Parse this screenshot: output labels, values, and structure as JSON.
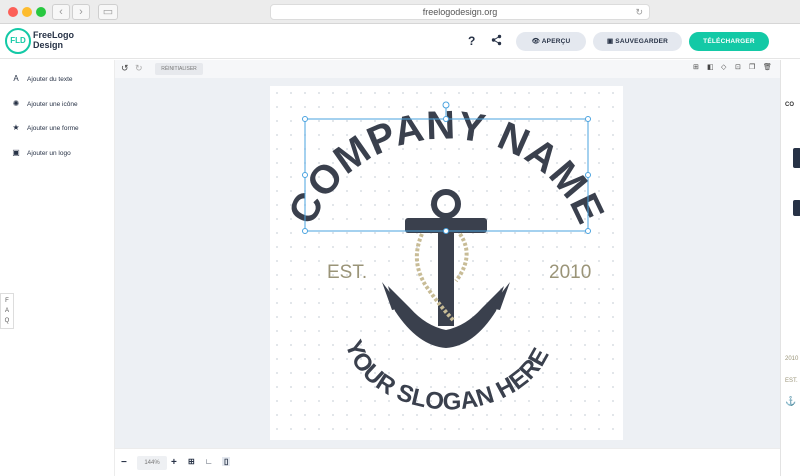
{
  "browser": {
    "url": "freelogodesign.org"
  },
  "header": {
    "logo_mark": "FLD",
    "logo_name": "FreeLogo Design",
    "help_icon": "?",
    "share_icon": "share-icon",
    "preview_label": "APERÇU",
    "save_label": "SAUVEGARDER",
    "download_label": "TÉLÉCHARGER",
    "accent_color": "#13c9a6"
  },
  "sidebar": {
    "items": [
      {
        "icon": "text-icon",
        "label": "Ajouter du texte"
      },
      {
        "icon": "icon-icon",
        "label": "Ajouter une icône"
      },
      {
        "icon": "star-icon",
        "label": "Ajouter une forme"
      },
      {
        "icon": "image-icon",
        "label": "Ajouter un logo"
      }
    ],
    "faq": "FAQ"
  },
  "toolbar": {
    "reset_label": "RÉINITIALISER"
  },
  "logo": {
    "company_name": "COMPANY NAME",
    "slogan": "YOUR SLOGAN HERE",
    "est_label": "EST.",
    "year": "2010",
    "dark_color": "#3a404d",
    "tan_color": "#9a9478"
  },
  "right_panel": {
    "label_co": "CO",
    "label_year": "2010",
    "label_est": "EST."
  },
  "zoom": {
    "value": "144%"
  }
}
